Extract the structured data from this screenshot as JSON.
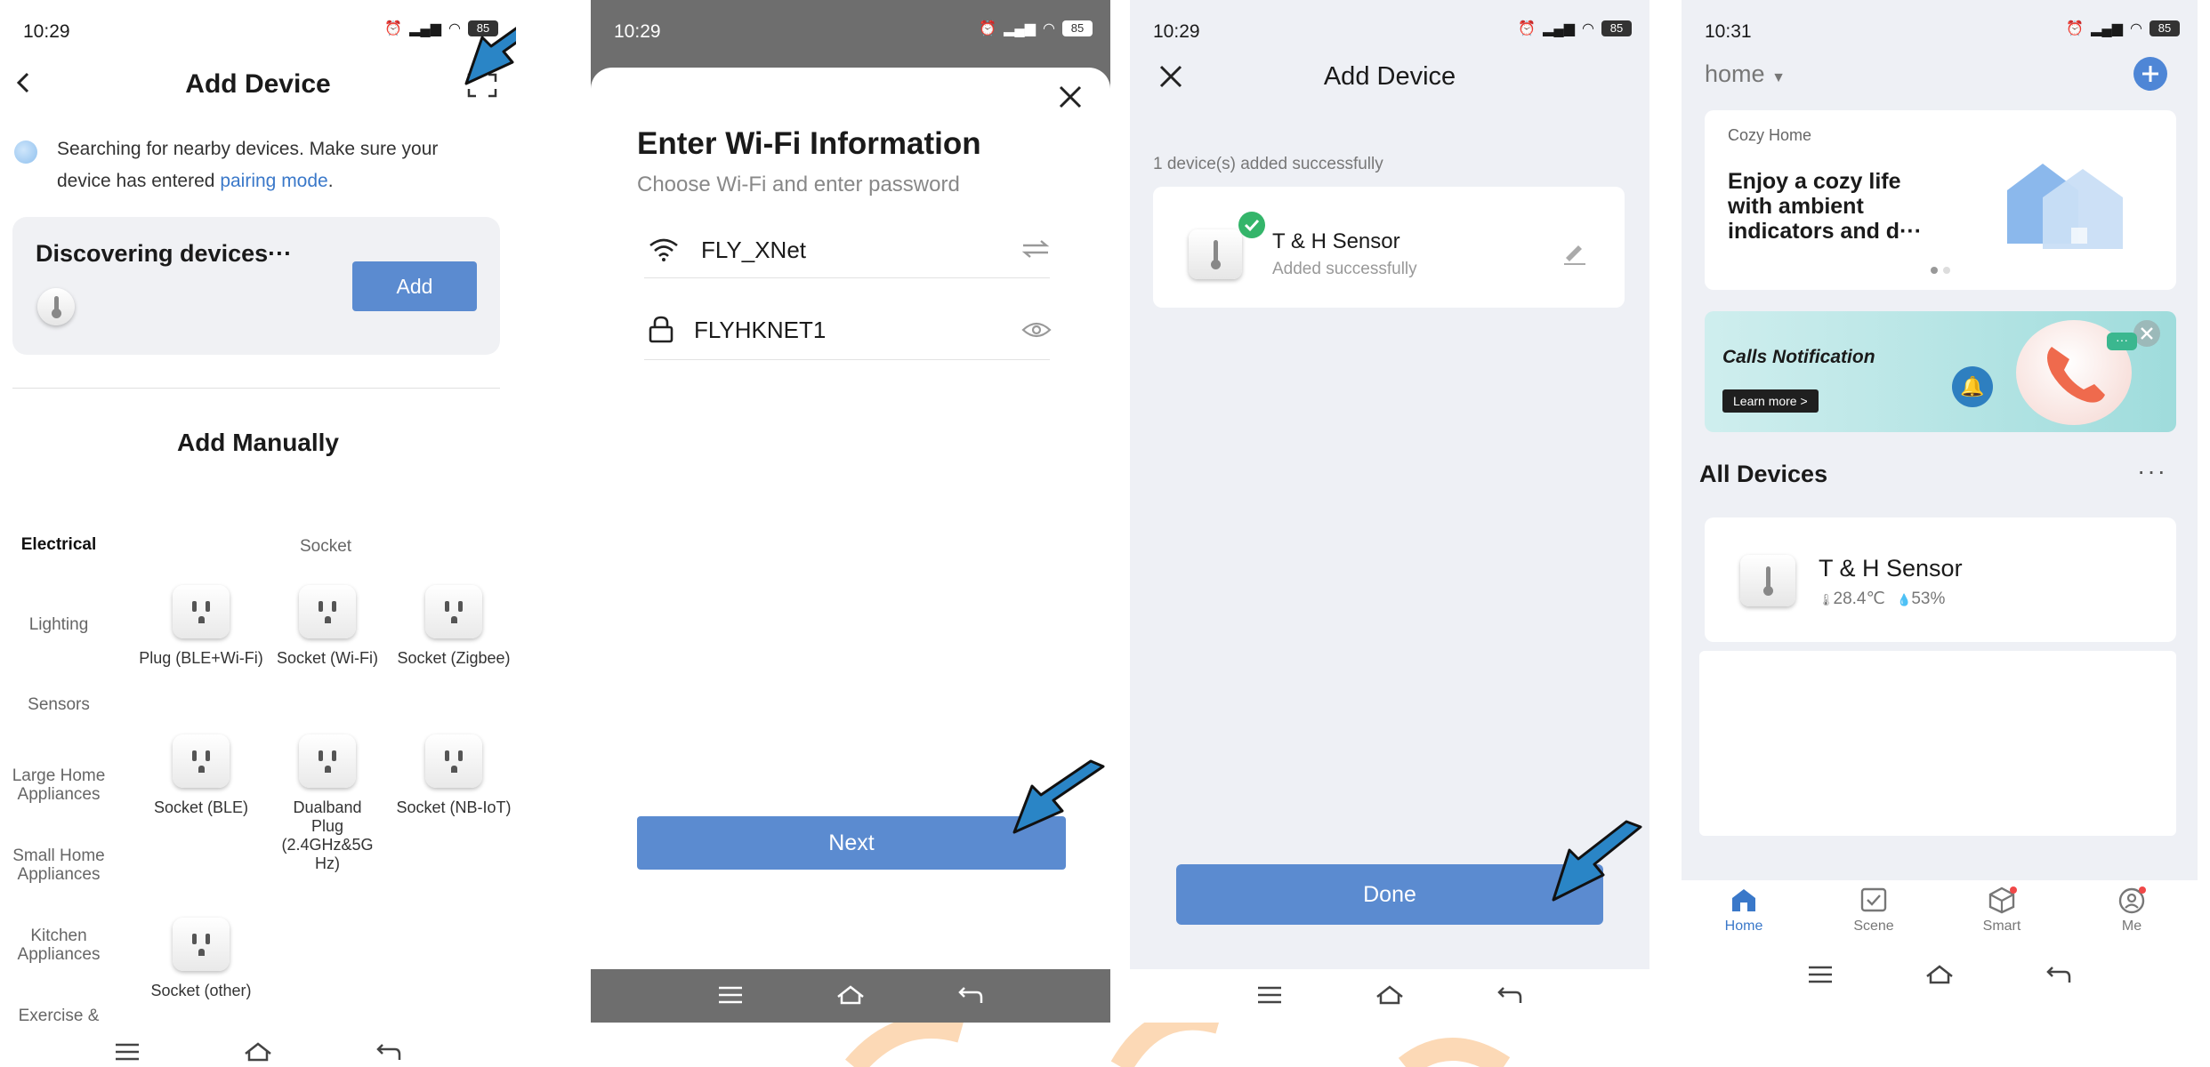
{
  "panel1": {
    "time": "10:29",
    "battery": "85",
    "title": "Add Device",
    "search_text": "Searching for nearby devices. Make sure your device has entered",
    "pairing_link": "pairing mode",
    "period": ".",
    "discovering": "Discovering devices···",
    "add_label": "Add",
    "add_manually": "Add Manually",
    "categories": [
      "Electrical",
      "Lighting",
      "Sensors",
      "Large Home Appliances",
      "Small Home Appliances",
      "Kitchen Appliances",
      "Exercise &"
    ],
    "section_label": "Socket",
    "sockets": [
      "Plug (BLE+Wi-Fi)",
      "Socket (Wi-Fi)",
      "Socket (Zigbee)",
      "Socket (BLE)",
      "Dualband Plug (2.4GHz&5G Hz)",
      "Socket (NB-IoT)",
      "Socket (other)"
    ]
  },
  "panel2": {
    "time": "10:29",
    "battery": "85",
    "title": "Enter Wi-Fi Information",
    "subtitle": "Choose Wi-Fi and enter password",
    "ssid": "FLY_XNet",
    "password": "FLYHKNET1",
    "next_label": "Next"
  },
  "panel3": {
    "time": "10:29",
    "battery": "85",
    "title": "Add Device",
    "success_count": "1 device(s) added successfully",
    "device_name": "T & H Sensor",
    "device_status": "Added successfully",
    "done_label": "Done"
  },
  "panel4": {
    "time": "10:31",
    "battery": "85",
    "home_label": "home",
    "banner_tag": "Cozy Home",
    "banner_text": "Enjoy a cozy life with ambient indicators and d···",
    "promo_title": "Calls Notification",
    "promo_button": "Learn more >",
    "all_devices": "All Devices",
    "device_name": "T & H Sensor",
    "device_temp": "28.4℃",
    "device_humidity": "53%",
    "tabs": [
      "Home",
      "Scene",
      "Smart",
      "Me"
    ]
  },
  "colors": {
    "accent": "#5b8bd0",
    "link": "#3a78c9",
    "success": "#34b56a",
    "arrow": "#2a85c6",
    "nav_dark": "#6e6e6e",
    "panel_bg": "#eef0f5",
    "badge_red": "#f04848",
    "watermark": "#f9b97a"
  }
}
